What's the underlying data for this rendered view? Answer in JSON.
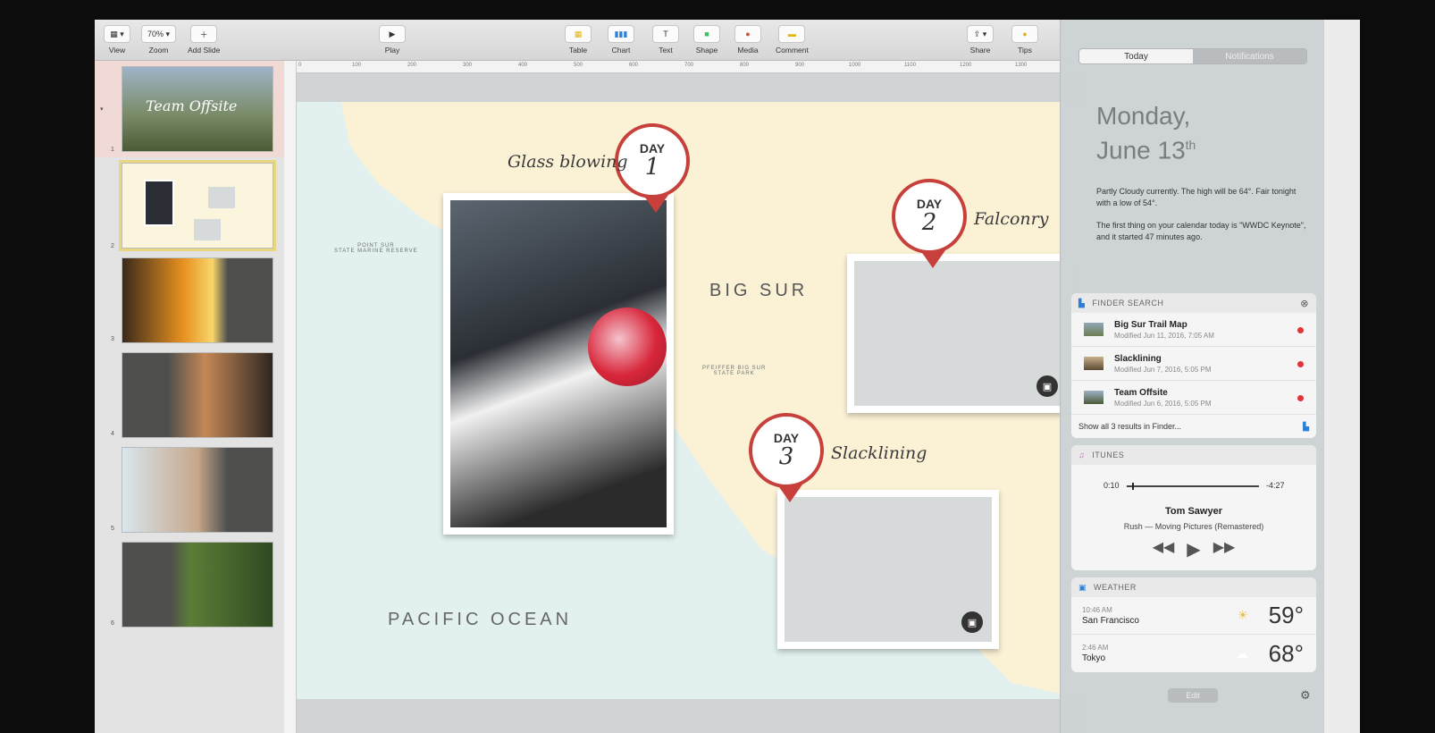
{
  "toolbar": {
    "view": "View",
    "zoom": "Zoom",
    "zoom_value": "70%",
    "add_slide": "Add Slide",
    "play": "Play",
    "table": "Table",
    "chart": "Chart",
    "text": "Text",
    "shape": "Shape",
    "media": "Media",
    "comment": "Comment",
    "share": "Share",
    "tips": "Tips"
  },
  "ruler_ticks": [
    "0",
    "100",
    "200",
    "300",
    "400",
    "500",
    "600",
    "700",
    "800",
    "900",
    "1000",
    "1100",
    "1200",
    "1300"
  ],
  "navigator": {
    "slide1_title": "Team Offsite",
    "numbers": [
      "1",
      "2",
      "3",
      "4",
      "5",
      "6"
    ]
  },
  "slide": {
    "pacific": "PACIFIC OCEAN",
    "bigsur": "BIG SUR",
    "point_sur": "POINT SUR\nSTATE MARINE RESERVE",
    "pfeiffer": "PFEIFFER BIG SUR\nSTATE PARK",
    "day1": {
      "day": "DAY",
      "num": "1",
      "activity": "Glass blowing"
    },
    "day2": {
      "day": "DAY",
      "num": "2",
      "activity": "Falconry"
    },
    "day3": {
      "day": "DAY",
      "num": "3",
      "activity": "Slacklining"
    }
  },
  "nc": {
    "tab_today": "Today",
    "tab_notifications": "Notifications",
    "date_line1": "Monday,",
    "date_line2": "June 13",
    "date_suffix": "th",
    "weather_summary": "Partly Cloudy currently. The high will be 64°. Fair tonight with a low of 54°.",
    "calendar_summary": "The first thing on your calendar today is \"WWDC Keynote\", and it started 47 minutes ago.",
    "finder": {
      "title": "FINDER SEARCH",
      "items": [
        {
          "name": "Big Sur Trail Map",
          "date": "Modified Jun 11, 2016, 7:05 AM"
        },
        {
          "name": "Slacklining",
          "date": "Modified Jun 7, 2016, 5:05 PM"
        },
        {
          "name": "Team Offsite",
          "date": "Modified Jun 6, 2016, 5:05 PM"
        }
      ],
      "show_all": "Show all 3 results in Finder..."
    },
    "itunes": {
      "title": "ITUNES",
      "elapsed": "0:10",
      "remaining": "-4:27",
      "track": "Tom Sawyer",
      "artist_album": "Rush — Moving Pictures (Remastered)",
      "progress": 0.04
    },
    "weather": {
      "title": "WEATHER",
      "rows": [
        {
          "time": "10:46 AM",
          "city": "San Francisco",
          "temp": "59°"
        },
        {
          "time": "2:46 AM",
          "city": "Tokyo",
          "temp": "68°"
        }
      ]
    },
    "edit": "Edit"
  }
}
